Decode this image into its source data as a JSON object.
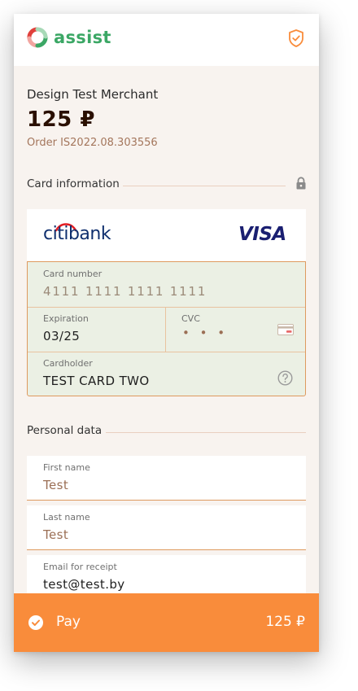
{
  "header": {
    "brand": "assist",
    "brand_color": "#3ba765",
    "shield_icon": "shield-check-icon"
  },
  "merchant": {
    "name": "Design Test Merchant",
    "amount": "125 ₽",
    "order": "Order IS2022.08.303556"
  },
  "card_section": {
    "title": "Card information",
    "lock_icon": "lock-icon",
    "bank_logo_text": "citibank",
    "network": "VISA",
    "fields": {
      "card_number": {
        "label": "Card number",
        "value": "4111 1111 1111 1111"
      },
      "expiration": {
        "label": "Expiration",
        "value": "03/25"
      },
      "cvc": {
        "label": "CVC",
        "value": "• • •"
      },
      "cardholder": {
        "label": "Cardholder",
        "value": "TEST CARD TWO"
      }
    }
  },
  "personal_section": {
    "title": "Personal data",
    "fields": {
      "first_name": {
        "label": "First name",
        "value": "Test"
      },
      "last_name": {
        "label": "Last name",
        "value": "Test"
      },
      "email": {
        "label": "Email for receipt",
        "value": "test@test.by"
      }
    }
  },
  "pay": {
    "label": "Pay",
    "amount": "125 ₽",
    "color": "#f98c3b"
  }
}
